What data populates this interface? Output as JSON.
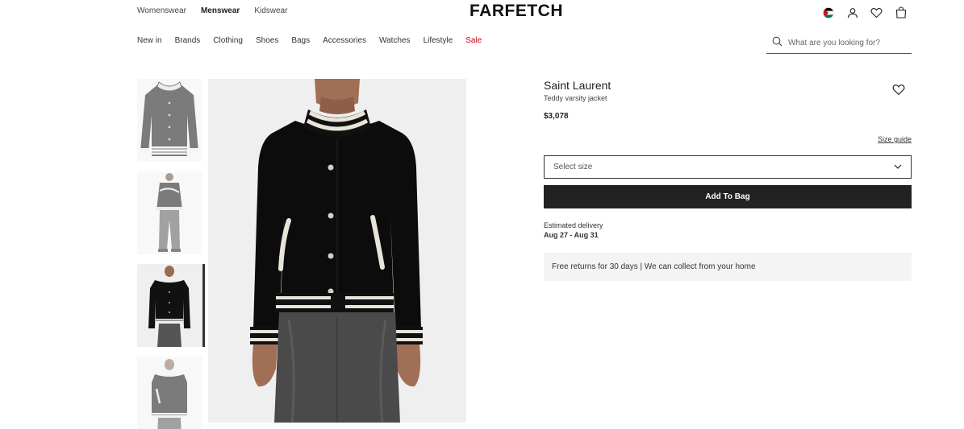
{
  "header": {
    "logo": "FARFETCH",
    "gender_tabs": [
      "Womenswear",
      "Menswear",
      "Kidswear"
    ],
    "active_gender": "Menswear",
    "categories": [
      {
        "label": "New in"
      },
      {
        "label": "Brands"
      },
      {
        "label": "Clothing"
      },
      {
        "label": "Shoes"
      },
      {
        "label": "Bags"
      },
      {
        "label": "Accessories"
      },
      {
        "label": "Watches"
      },
      {
        "label": "Lifestyle"
      },
      {
        "label": "Sale",
        "highlight": true
      }
    ],
    "search_placeholder": "What are you looking for?",
    "icons": [
      "flag-icon",
      "account-icon",
      "wishlist-icon",
      "bag-icon"
    ]
  },
  "gallery": {
    "thumbnail_count": 4,
    "active_index": 2
  },
  "product": {
    "brand": "Saint Laurent",
    "name": "Teddy varsity jacket",
    "price": "$3,078",
    "size_guide": "Size guide",
    "size_placeholder": "Select size",
    "add_to_bag": "Add To Bag",
    "delivery_label": "Estimated delivery",
    "delivery_dates": "Aug 27 - Aug 31",
    "returns_text": "Free returns for 30 days | We can collect from your home"
  },
  "colors": {
    "accent_sale": "#d0021b",
    "button_bg": "#222222",
    "returns_bg": "#f4f4f4"
  }
}
